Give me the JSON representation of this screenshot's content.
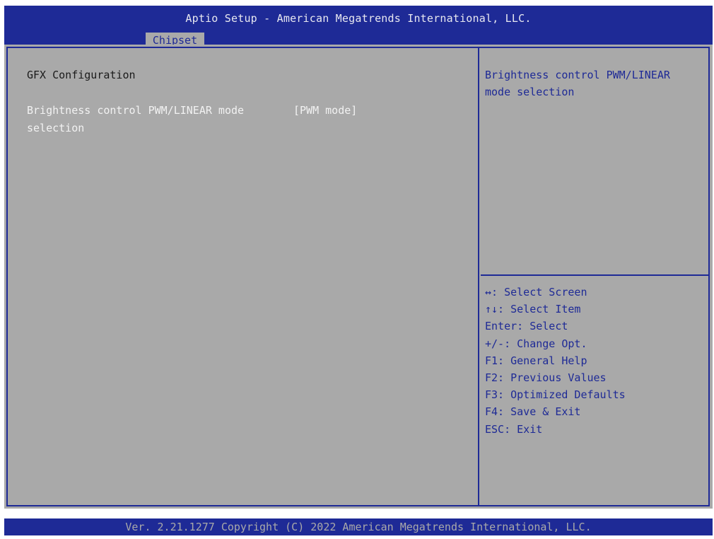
{
  "header": {
    "title": "Aptio Setup - American Megatrends International, LLC.",
    "active_tab": "Chipset"
  },
  "main": {
    "section_title": "GFX Configuration",
    "settings": [
      {
        "label": "Brightness control PWM/LINEAR mode selection",
        "value": "[PWM mode]"
      }
    ]
  },
  "help_panel": {
    "description": "Brightness control PWM/LINEAR mode selection",
    "keys": [
      "↔: Select Screen",
      "↑↓: Select Item",
      "Enter: Select",
      "+/-: Change Opt.",
      "F1: General Help",
      "F2: Previous Values",
      "F3: Optimized Defaults",
      "F4: Save & Exit",
      "ESC: Exit"
    ]
  },
  "footer": {
    "copyright": "Ver. 2.21.1277 Copyright (C) 2022 American Megatrends International, LLC."
  },
  "colors": {
    "bios_blue": "#1e2a96",
    "panel_gray": "#a9a9a9",
    "selected_text": "#f2f2f2"
  }
}
